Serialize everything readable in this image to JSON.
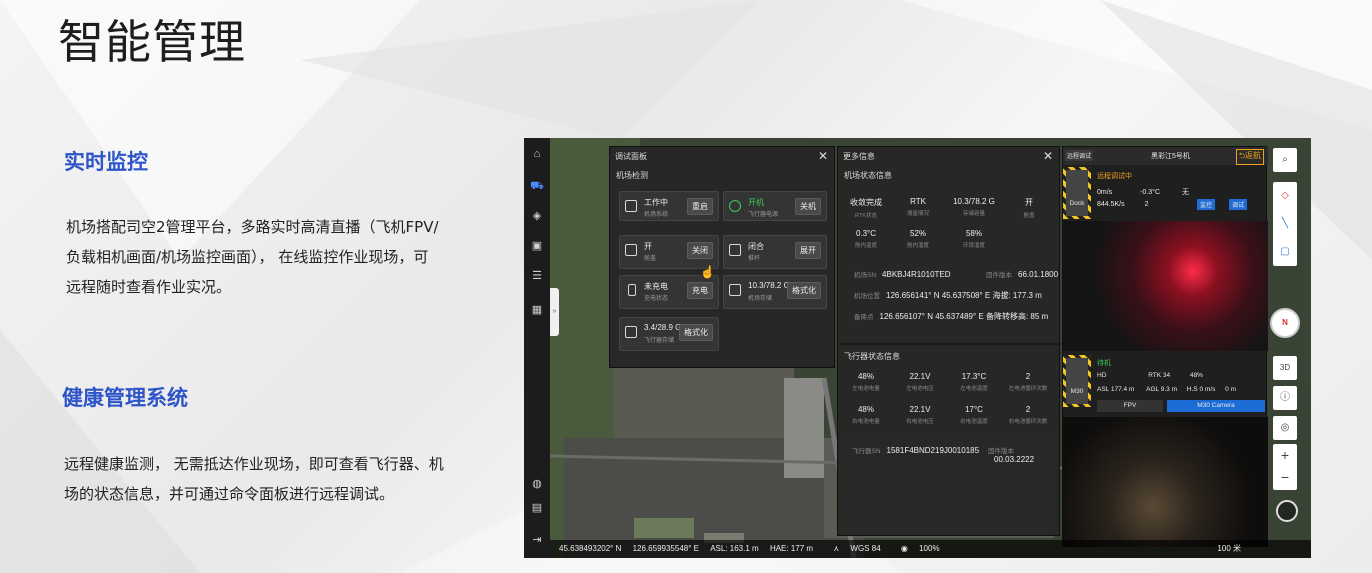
{
  "page": {
    "title": "智能管理",
    "sections": [
      {
        "title": "实时监控",
        "lines": [
          "机场搭配司空2管理平台，多路实时高清直播（飞机FPV/",
          "负载相机画面/机场监控画面）， 在线监控作业现场，可",
          "远程随时查看作业实况。"
        ]
      },
      {
        "title": "健康管理系统",
        "lines": [
          "远程健康监测， 无需抵达作业现场，即可查看飞行器、机",
          "场的状态信息，并可通过命令面板进行远程调试。"
        ]
      }
    ]
  },
  "app": {
    "debug_panel": {
      "title": "调试面板",
      "section": "机场检测",
      "items": [
        {
          "icon": "system-icon",
          "value": "工作中",
          "label": "机场系统",
          "button": "重启"
        },
        {
          "icon": "power-icon",
          "value": "开机",
          "label": "飞行器电源",
          "button": "关机"
        },
        {
          "icon": "hatch-icon",
          "value": "开",
          "label": "舱盖",
          "button": "关闭"
        },
        {
          "icon": "pushrod-icon",
          "value": "闭合",
          "label": "推杆",
          "button": "展开"
        },
        {
          "icon": "battery-icon",
          "value": "未充电",
          "label": "充电状态",
          "button": "充电"
        },
        {
          "icon": "storage-icon",
          "value": "10.3/78.2 G",
          "label": "机场存储",
          "button": "格式化"
        },
        {
          "icon": "storage-icon",
          "value": "3.4/28.9 G",
          "label": "飞行器存储",
          "button": "格式化"
        }
      ]
    },
    "more_panel": {
      "title": "更多信息",
      "dock_section": "机场状态信息",
      "dock_stats": [
        {
          "v": "收敛完成",
          "k": "RTK状态"
        },
        {
          "v": "RTK",
          "k": "搜星情况"
        },
        {
          "v": "10.3/78.2 G",
          "k": "存储容量"
        },
        {
          "v": "开",
          "k": "舱盖"
        },
        {
          "v": "0.3°C",
          "k": "舱内温度"
        },
        {
          "v": "52%",
          "k": "舱内湿度"
        },
        {
          "v": "58%",
          "k": "环境湿度"
        }
      ],
      "dock_kv": [
        {
          "k": "机场SN",
          "v": "4BKBJ4R1010TED",
          "k2": "固件版本",
          "v2": "66.01.1800"
        },
        {
          "k": "机场位置",
          "v": "126.656141° N  45.637508° E  海拔: 177.3 m"
        },
        {
          "k": "备降点",
          "v": "126.656107° N  45.637489° E  备降转移高: 85 m"
        }
      ],
      "drone_section": "飞行器状态信息",
      "drone_stats": [
        {
          "v": "48%",
          "k": "左电池电量"
        },
        {
          "v": "22.1V",
          "k": "左电池电压"
        },
        {
          "v": "17.3°C",
          "k": "左电池温度"
        },
        {
          "v": "2",
          "k": "左电池循环次数"
        },
        {
          "v": "48%",
          "k": "右电池电量"
        },
        {
          "v": "22.1V",
          "k": "右电池电压"
        },
        {
          "v": "17°C",
          "k": "右电池温度"
        },
        {
          "v": "2",
          "k": "右电池循环次数"
        }
      ],
      "drone_kv": {
        "k": "飞行器SN",
        "v": "1581F4BND219J0010185",
        "k2": "固件版本",
        "v2": "00.03.2222"
      }
    },
    "live_panel": {
      "tab": "远程调试",
      "name": "黑彩江5号机",
      "back": "返航",
      "dock_label": "Dock",
      "status": "远程调试中",
      "row1": [
        "0m/s",
        "-0.3°C",
        "无"
      ],
      "row2": [
        "844.5K/s",
        "2"
      ],
      "btn_monitor": "监控",
      "btn_debug": "调试",
      "m30_label": "M30",
      "drone_status": "待机",
      "hd": "HD",
      "rtk": "RTK",
      "rtk_count": "34",
      "battery": "48%",
      "asl": "ASL 177.4 m",
      "agl": "AGL 9.3 m",
      "hs": "H.S 0 m/s",
      "dist": "0 m",
      "fpv": "FPV",
      "camera": "M30 Camera"
    },
    "statusbar": {
      "lat": "45.638493202° N",
      "lon": "126.659935548° E",
      "asl": "ASL: 163.1 m",
      "hae": "HAE: 177 m",
      "wgs": "WGS 84",
      "zoom": "100%",
      "scale": "100 米"
    },
    "compass": "N",
    "view3d": "3D"
  }
}
